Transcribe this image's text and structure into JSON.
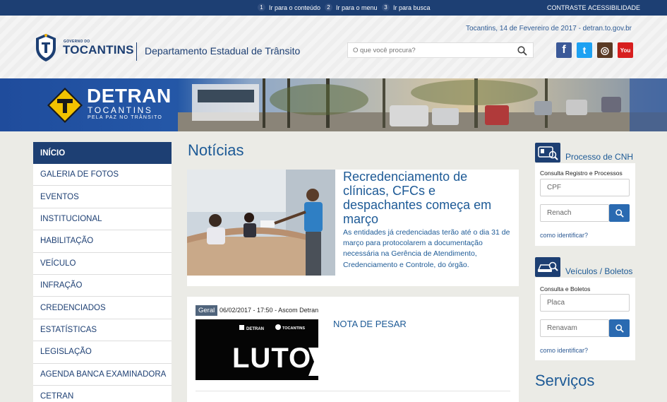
{
  "topbar": {
    "skip_links": [
      {
        "num": "1",
        "label": "Ir para o conteúdo"
      },
      {
        "num": "2",
        "label": "Ir para o menu"
      },
      {
        "num": "3",
        "label": "Ir para busca"
      }
    ],
    "contrast": "CONTRASTE",
    "accessibility": "ACESSIBILIDADE"
  },
  "header": {
    "gov_small": "GOVERNO DO",
    "gov_name": "TOCANTINS",
    "department": "Departamento Estadual de Trânsito",
    "dateline": "Tocantins, 14 de Fevereiro de 2017 - detran.to.gov.br",
    "search_placeholder": "O que você procura?",
    "social": [
      {
        "icon": "facebook-icon",
        "glyph": "f",
        "color": "#3b5998"
      },
      {
        "icon": "twitter-icon",
        "glyph": "t",
        "color": "#1da1f2"
      },
      {
        "icon": "instagram-icon",
        "glyph": "◎",
        "color": "#5a3a24"
      },
      {
        "icon": "youtube-icon",
        "glyph": "You",
        "color": "#d71e1e"
      }
    ]
  },
  "banner": {
    "title": "DETRAN",
    "subtitle": "TOCANTINS",
    "tagline": "PELA PAZ NO TRÂNSITO"
  },
  "sidebar": {
    "items": [
      {
        "label": "INÍCIO",
        "active": true
      },
      {
        "label": "GALERIA DE FOTOS"
      },
      {
        "label": "EVENTOS"
      },
      {
        "label": "INSTITUCIONAL"
      },
      {
        "label": "HABILITAÇÃO"
      },
      {
        "label": "VEÍCULO"
      },
      {
        "label": "INFRAÇÃO"
      },
      {
        "label": "CREDENCIADOS"
      },
      {
        "label": "ESTATÍSTICAS"
      },
      {
        "label": "LEGISLAÇÃO"
      },
      {
        "label": "AGENDA BANCA EXAMINADORA"
      },
      {
        "label": "CETRAN"
      }
    ]
  },
  "main": {
    "title": "Notícias",
    "featured": {
      "title": "Recredenciamento de clínicas, CFCs e despachantes começa em março",
      "text": "As entidades já credenciadas terão até o dia 31 de março para protocolarem a documentação necessária na Gerência de Atendimento, Credenciamento e Controle, do órgão."
    },
    "news": {
      "badge": "Geral",
      "meta": "06/02/2017 - 17:50 - Ascom Detran",
      "title": "NOTA DE PESAR",
      "image_text": "LUTO",
      "image_logo_1": "DETRAN",
      "image_logo_2": "TOCANTINS"
    }
  },
  "widgets": {
    "cnh": {
      "title": "Processo de CNH",
      "label": "Consulta Registro e Processos",
      "field1": "CPF",
      "field2": "Renach",
      "link": "como identificar?"
    },
    "veiculos": {
      "title": "Veículos / Boletos",
      "label": "Consulta e Boletos",
      "field1": "Placa",
      "field2": "Renavam",
      "link": "como identificar?"
    },
    "servicos": "Serviços"
  }
}
